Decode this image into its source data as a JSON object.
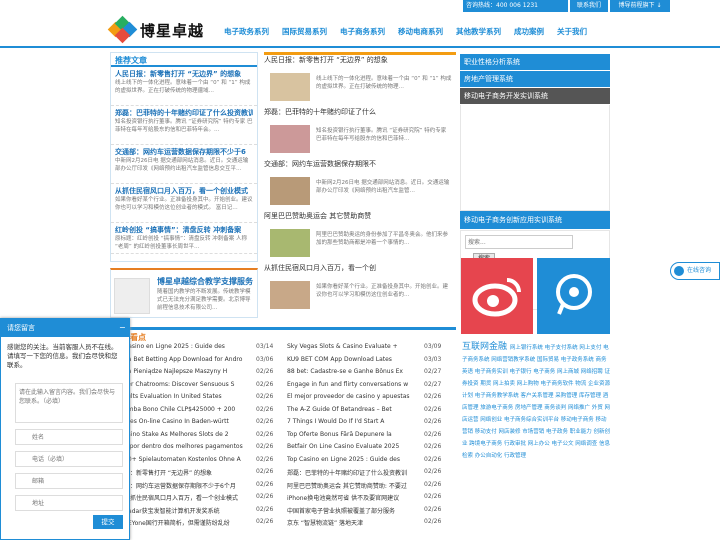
{
  "topbar": {
    "hotline": "咨询热线：400 006 1231",
    "contact": "联系我们",
    "link": "博导前程旗下 ↓"
  },
  "logo": {
    "name": "博星卓越"
  },
  "nav": [
    "电子政务系列",
    "国际贸易系列",
    "电子商务系列",
    "移动电商系列",
    "其他教学系列",
    "成功案例",
    "关于我们"
  ],
  "recommend": {
    "title": "推荐文章",
    "items": [
      {
        "t": "人民日报：新零售打开 “无边界” 的想象",
        "d": "线上线下的一体化进程。意味着一个由 “0” 和 “1” 构成的虚拟世界。正在打破传统的物理疆域…"
      },
      {
        "t": "郑磊：巴菲特的十年赌约印证了什么投资教训",
        "d": "知名投资银行执行董事。腾讯 “证券研究院” 特约专家 巴菲特在每年写给股东的信和巴菲特年会。…"
      },
      {
        "t": "交通部：网约车运营数据保存期限不少于6",
        "d": "中新网2月26日电 据交通部网站消息。近日。交通运输部办公厅印发《网络预约出租汽车监管信息交互平…"
      },
      {
        "t": "从抓住民宿风口月入百万，看一个创业模式",
        "d": "如果你看好某个行业。正准备投身其中。开始创业。建议你也可以学习和模仿这位创业者的模式。 富日记…"
      },
      {
        "t": "红岭创投 “搞事情”：清盘反转 冲刺备案",
        "d": "原标题：红岭创投 “搞事情”：清盘反转 冲刺备案 人称 “老周” 的红岭创投董事长周世平…"
      }
    ]
  },
  "platform": {
    "title": "博星卓越综合教学支撑服务",
    "d": "随着国内教学的不断发展。传统教学模式已无法充分满足教学需要。北京博导前程信息技术有限公司…"
  },
  "news": [
    {
      "t": "人民日报：新零售打开 “无边界” 的想象",
      "d": "线上线下的一体化进程。意味着一个由 “0” 和 “1” 构成的虚拟世界。正在打破传统的物理…"
    },
    {
      "t": "郑磊：巴菲特的十年赌约印证了什么",
      "d": "知名投资银行执行董事。腾讯 “证券研究院” 特约专家 巴菲特在每年写给股东的信和巴菲特…"
    },
    {
      "t": "交通部：网约车运营数据保存期限不",
      "d": "中新网2月26日电 据交通部网站消息。近日。交通运输部办公厅印发《网络预约出租汽车监管…"
    },
    {
      "t": "阿里巴巴赞助奥运会 其它赞助商赞",
      "d": "阿里巴巴赞助奥运的身份参加了平昌冬奥会。他们来参加的那些赞助商都是冲着一个事情的…"
    },
    {
      "t": "从抓住民宿风口月入百万，看一个创",
      "d": "如果你看好某个行业。正准备投身其中。开始创业。建议你也可以学习和模仿这位创业者的…"
    }
  ],
  "sidebar": {
    "items": [
      "职业性格分析系统",
      "房地产管理系统",
      "移动电子商务开发实训系统"
    ],
    "item2": "移动电子商务创新应用实训系统",
    "search_placeholder": "搜索...",
    "search_btn": "搜索"
  },
  "hot": {
    "title": "热门看点",
    "left": [
      [
        "Casino en Ligne 2025 : Guide des",
        "03/14"
      ],
      [
        "na Bet Betting App Download for Andro",
        "03/06"
      ],
      [
        "na Pieniądze Najlepsze Maszyny H",
        "02/26"
      ],
      [
        "ker Chatrooms: Discover Sensuous S",
        "02/26"
      ],
      [
        "sults Evaluation In United States",
        "02/26"
      ],
      [
        "amba Bono Chile CLP$425000 + 200",
        "02/26"
      ],
      [
        "ates On-line Casino In Baden-württ",
        "02/26"
      ],
      [
        "asino Stake As Melhores Slots de 2",
        "02/26"
      ],
      [
        "e por dentro dos melhores pagamentos",
        "02/26"
      ],
      [
        "00+ Spielautomaten Kostenlos Ohne A",
        "02/26"
      ],
      [
        "报：新零售打开 “无边界” 的想象",
        "02/26"
      ],
      [
        "磊：网约车运营数据保存期限不少于6个月",
        "02/26"
      ],
      [
        "从抓住民宿风口月入百万，看一个创业模式",
        "02/26"
      ],
      [
        "Radar获宝发智能计算机开发奖系统",
        "02/26"
      ],
      [
        "KEYone国行开箱简析，但需谨防纷乱纷",
        "02/26"
      ]
    ],
    "right": [
      [
        "Sky Vegas Slots & Casino Evaluate +",
        "03/09"
      ],
      [
        "KU9 BET COM App Download Lates",
        "03/03"
      ],
      [
        "88 bet: Cadastre-se e Ganhe Bônus Ex",
        "02/27"
      ],
      [
        "Engage in fun and flirty conversations w",
        "02/27"
      ],
      [
        "El mejor proveedor de casino y apuestas",
        "02/26"
      ],
      [
        "The A-Z Guide Of Betandreas – Bet",
        "02/26"
      ],
      [
        "7 Things I Would Do If I'd Start A",
        "02/26"
      ],
      [
        "Top Oferte Bonus Fără Depunere la",
        "02/26"
      ],
      [
        "Betfair On Line Casino Evaluate 2025",
        "02/26"
      ],
      [
        "Top Casino en Ligne 2025 : Guide des",
        "02/26"
      ],
      [
        "郑磊：巴菲特的十年赌约印证了什么投资教训",
        "02/26"
      ],
      [
        "阿里巴巴赞助奥运会 其它赞助商赞助: 不要过",
        "02/26"
      ],
      [
        "iPhone换电池竟然可省 供不及要官网建议",
        "02/26"
      ],
      [
        "中国首家电子营业执照被覆盖了部分服务",
        "02/26"
      ],
      [
        "京东 “智慧物流链” 落地天津",
        "02/26"
      ]
    ]
  },
  "chat": {
    "title": "请您留言",
    "msg": "感谢您的关注。当前客服人员不在线。请填写一下您的信息。我们会尽快和您联系。",
    "ph_msg": "请在此输入留言内容。我们会尽快与您联系。（必填）",
    "ph_name": "姓名",
    "ph_phone": "电话（必填）",
    "ph_email": "邮箱",
    "ph_addr": "地址",
    "send": "提交"
  },
  "sidechat": "在线咨询",
  "tags": "网上银行系统 电子支付系统 网上支付 电子商务系统 网络营销教学系统 国际贸易 电子政务系统 商务英语 电子商务实训 电子银行 电子商务 网上商城 网络招聘 证券投资 期货 网上拍卖 网上购物 电子商务软件 物流 企业资源计划 电子商务教学系统 客户关系管理 采购管理 库存管理 酒店管理 旅游电子商务 房地产管理 商务谈判 网络推广 外贸 网店运营 网络创业 电子商务综合实训平台 移动电子商务 移动营销 移动支付 网店装修 市场营销 电子政务 职业能力 创新创业 跨境电子商务 行政审批 网上办公 电子公文 网络调查 信息检索 办公自动化 行政管理",
  "colors": {
    "brand": "#1f8dd6",
    "accent": "#e67e22"
  }
}
